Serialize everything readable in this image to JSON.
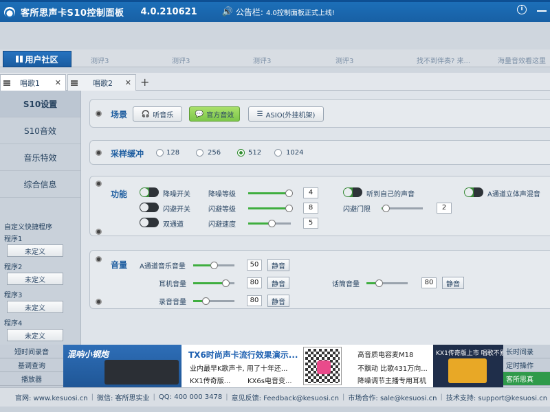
{
  "titlebar": {
    "title": "客所思声卡S10控制面板",
    "version": "4.0.210621",
    "notice_label": "公告栏:",
    "notice_text": "4.0控制面板正式上线!"
  },
  "community": {
    "button_label": "用户社区",
    "items": [
      "测评3",
      "测评3",
      "测评3",
      "测评3",
      "找不到伴奏? 来...",
      "海量音效看这里"
    ]
  },
  "tabs": [
    {
      "label": "唱歌1",
      "active": true
    },
    {
      "label": "唱歌2",
      "active": false
    }
  ],
  "sidebar": {
    "items": [
      "S10设置",
      "S10音效",
      "音乐特效",
      "综合信息"
    ],
    "shortcut_title": "自定义快捷程序",
    "programs": [
      {
        "label": "程序1",
        "button": "未定义"
      },
      {
        "label": "程序2",
        "button": "未定义"
      },
      {
        "label": "程序3",
        "button": "未定义"
      },
      {
        "label": "程序4",
        "button": "未定义"
      }
    ]
  },
  "scene": {
    "title": "场景",
    "buttons": [
      "听音乐",
      "官方音效",
      "ASIO(外挂机架)"
    ]
  },
  "sampling": {
    "title": "采样缓冲",
    "options": [
      "128",
      "256",
      "512",
      "1024"
    ],
    "selected": "512"
  },
  "function": {
    "title": "功能",
    "denoise_label": "降噪开关",
    "denoise_level_label": "降噪等级",
    "denoise_level": "4",
    "denoise_level_fraction": 0.95,
    "flash_label": "闪避开关",
    "flash_level_label": "闪避等级",
    "flash_level": "8",
    "flash_level_fraction": 0.95,
    "dual_label": "双通道",
    "flash_speed_label": "闪避速度",
    "flash_speed": "5",
    "flash_speed_fraction": 0.55,
    "hear_self_label": "听到自己的声音",
    "threshold_label": "闪避门限",
    "threshold": "2",
    "threshold_fraction": 0.1,
    "stereo_label": "A通道立体声混音"
  },
  "volume": {
    "title": "音量",
    "a_music_label": "A通道音乐音量",
    "a_music": "50",
    "a_music_fraction": 0.5,
    "earphone_label": "耳机音量",
    "earphone": "80",
    "earphone_fraction": 0.78,
    "mic_label": "话筒音量",
    "mic": "80",
    "mic_fraction": 0.3,
    "record_label": "录音音量",
    "record": "80",
    "record_fraction": 0.3,
    "mute_label": "静音"
  },
  "bottom_left": [
    "短时间录音",
    "基调查询",
    "播放器"
  ],
  "ads": {
    "ad1_title": "混响小钢炮",
    "ad2_title": "TX6时尚声卡流行效果演示...",
    "ad2_line1": "业内最早K歌声卡, 用了十年还...",
    "ad2_line2a": "KX1传奇版...",
    "ad2_line2b": "KX6s电音变...",
    "ad3_line1": "高音质电容麦M18",
    "ad3_line2": "不飘动 比歌431万向...",
    "ad3_line3": "降噪调节主播专用耳机",
    "ad4_title": "KX1传奇版上市 唱歌不累"
  },
  "bottom_right": [
    "长时间录",
    "定时操作",
    "客所思真"
  ],
  "footer": {
    "items": [
      "官网: www.kesuosi.cn",
      "微信: 客所思实业",
      "QQ: 400 000 3478",
      "意见反馈: Feedback@kesuosi.cn",
      "市场合作: sale@kesuosi.cn",
      "技术支持: support@kesuosi.cn"
    ]
  }
}
